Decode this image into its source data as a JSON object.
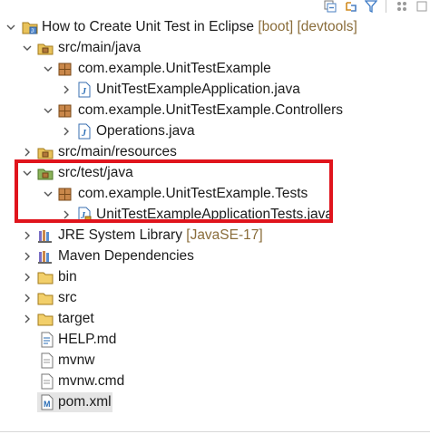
{
  "colors": {
    "highlight": "#e0141c",
    "package": "#8c5a2b",
    "java": "#2a6db5",
    "folder": "#d4a53c",
    "deco": "#8a6d3b"
  },
  "toolbar": {
    "icons": [
      "collapse-all-icon",
      "link-with-editor-icon",
      "filter-icon",
      "view-menu-icon"
    ]
  },
  "tree": [
    {
      "label": "How to Create Unit Test in Eclipse",
      "decoration": " [boot] [devtools]",
      "icon": "project-icon",
      "expanded": true
    },
    {
      "label": "src/main/java",
      "icon": "source-folder-icon",
      "expanded": true
    },
    {
      "label": "com.example.UnitTestExample",
      "icon": "package-icon",
      "expanded": true
    },
    {
      "label": "UnitTestExampleApplication.java",
      "icon": "java-file-icon",
      "expanded": false
    },
    {
      "label": "com.example.UnitTestExample.Controllers",
      "icon": "package-icon",
      "expanded": true
    },
    {
      "label": "Operations.java",
      "icon": "java-file-icon",
      "expanded": false
    },
    {
      "label": "src/main/resources",
      "icon": "source-folder-icon",
      "expanded": false
    },
    {
      "label": "src/test/java",
      "icon": "test-source-folder-icon",
      "expanded": true
    },
    {
      "label": "com.example.UnitTestExample.Tests",
      "icon": "test-package-icon",
      "expanded": true
    },
    {
      "label": "UnitTestExampleApplicationTests.java",
      "icon": "test-java-file-icon",
      "expanded": false
    },
    {
      "label": "JRE System Library",
      "decoration": " [JavaSE-17]",
      "icon": "library-icon",
      "expanded": false
    },
    {
      "label": "Maven Dependencies",
      "icon": "library-icon",
      "expanded": false
    },
    {
      "label": "bin",
      "icon": "folder-icon",
      "expanded": false
    },
    {
      "label": "src",
      "icon": "folder-icon",
      "expanded": false
    },
    {
      "label": "target",
      "icon": "folder-icon",
      "expanded": false
    },
    {
      "label": "HELP.md",
      "icon": "markdown-file-icon"
    },
    {
      "label": "mvnw",
      "icon": "file-icon"
    },
    {
      "label": "mvnw.cmd",
      "icon": "file-icon"
    },
    {
      "label": "pom.xml",
      "icon": "maven-pom-icon",
      "selected": true
    }
  ]
}
